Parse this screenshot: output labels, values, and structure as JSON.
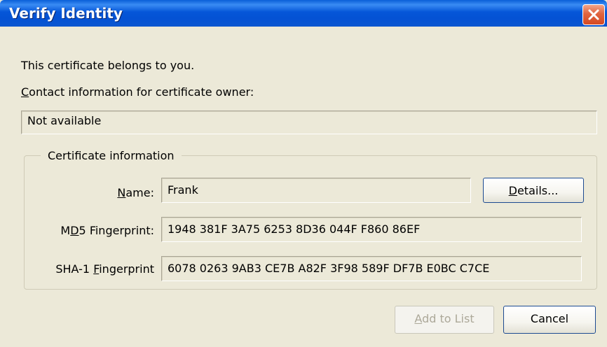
{
  "window": {
    "title": "Verify Identity"
  },
  "intro": {
    "belongs_text": "This certificate belongs to you.",
    "contact_label_accel": "C",
    "contact_label_rest": "ontact information for certificate owner:",
    "contact_value": "Not available"
  },
  "certificate": {
    "group_title": "Certificate information",
    "name_label_accel": "N",
    "name_label_rest": "ame:",
    "name_value": "Frank",
    "details_accel": "D",
    "details_rest": "etails...",
    "md5_label_pre": "M",
    "md5_label_accel": "D",
    "md5_label_rest": "5 Fingerprint:",
    "md5_value": "1948 381F 3A75 6253 8D36 044F F860 86EF",
    "sha1_label_pre": "SHA-1 ",
    "sha1_label_accel": "F",
    "sha1_label_rest": "ingerprint",
    "sha1_value": "6078 0263 9AB3 CE7B A82F 3F98 589F DF7B E0BC C7CE"
  },
  "buttons": {
    "add_accel": "A",
    "add_rest": "dd to List",
    "cancel": "Cancel"
  },
  "colors": {
    "titlebar": "#0452d4",
    "close_button": "#d54a23",
    "dialog_background": "#ece9d8",
    "button_border": "#1c4a91"
  },
  "icons": {
    "close": "close-icon"
  }
}
